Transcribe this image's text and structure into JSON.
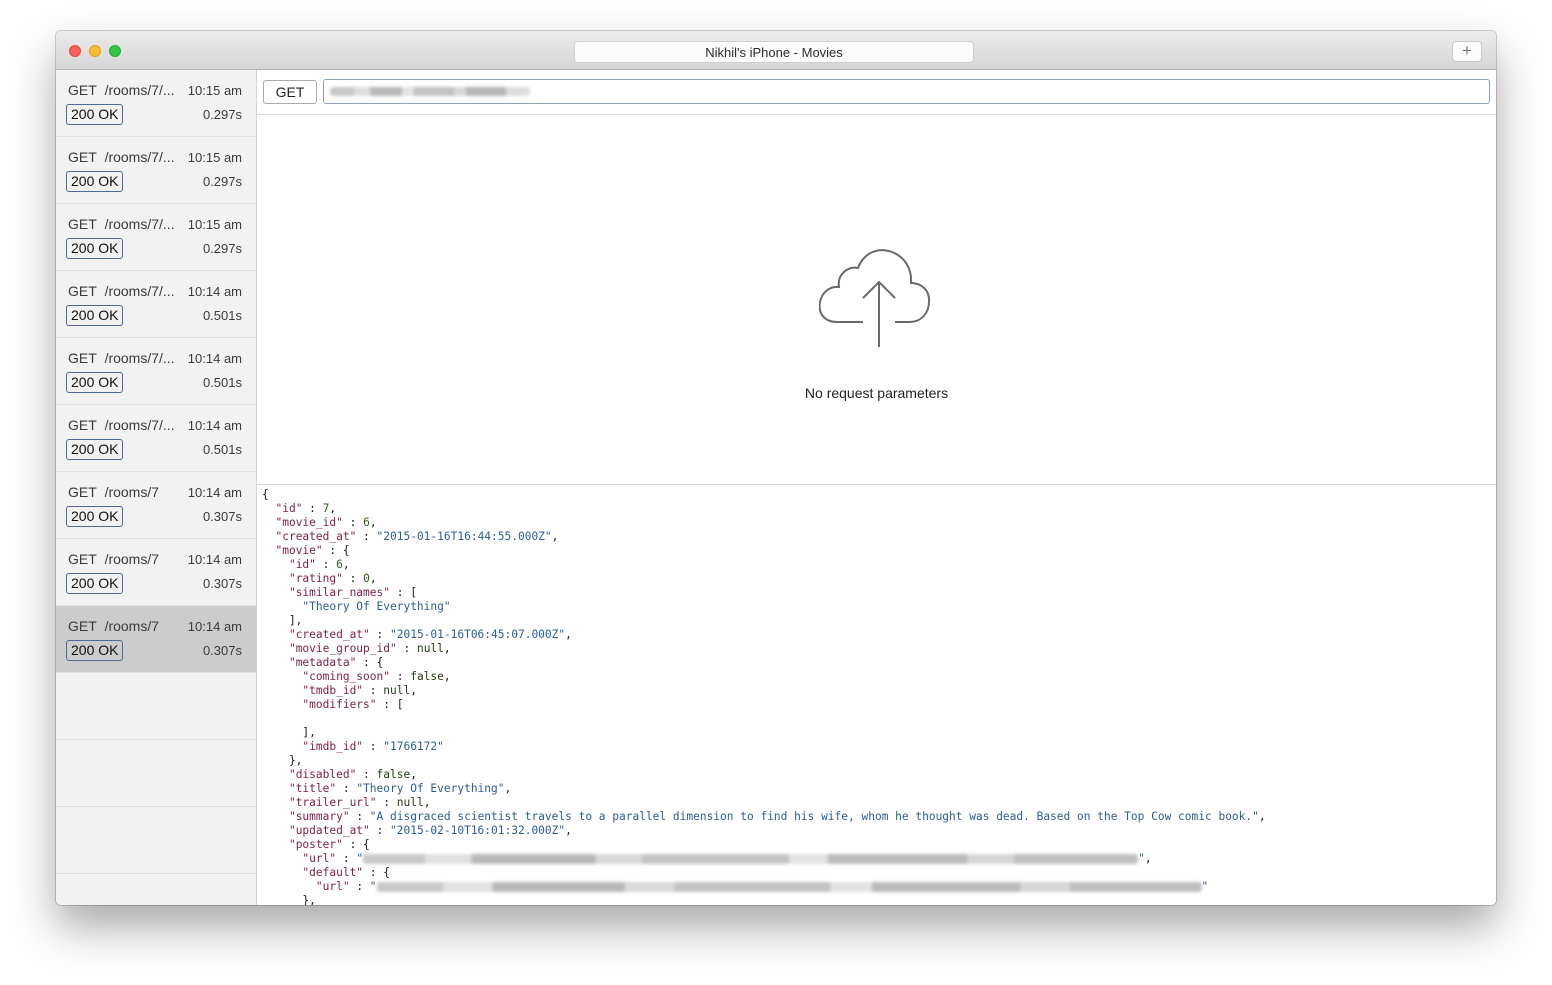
{
  "window": {
    "title": "Nikhil's iPhone - Movies",
    "add_label": "+"
  },
  "requests": [
    {
      "method": "GET",
      "path": "/rooms/7/...",
      "time": "10:15 am",
      "status": "200 OK",
      "duration": "0.297s",
      "selected": false
    },
    {
      "method": "GET",
      "path": "/rooms/7/...",
      "time": "10:15 am",
      "status": "200 OK",
      "duration": "0.297s",
      "selected": false
    },
    {
      "method": "GET",
      "path": "/rooms/7/...",
      "time": "10:15 am",
      "status": "200 OK",
      "duration": "0.297s",
      "selected": false
    },
    {
      "method": "GET",
      "path": "/rooms/7/...",
      "time": "10:14 am",
      "status": "200 OK",
      "duration": "0.501s",
      "selected": false
    },
    {
      "method": "GET",
      "path": "/rooms/7/...",
      "time": "10:14 am",
      "status": "200 OK",
      "duration": "0.501s",
      "selected": false
    },
    {
      "method": "GET",
      "path": "/rooms/7/...",
      "time": "10:14 am",
      "status": "200 OK",
      "duration": "0.501s",
      "selected": false
    },
    {
      "method": "GET",
      "path": "/rooms/7",
      "time": "10:14 am",
      "status": "200 OK",
      "duration": "0.307s",
      "selected": false
    },
    {
      "method": "GET",
      "path": "/rooms/7",
      "time": "10:14 am",
      "status": "200 OK",
      "duration": "0.307s",
      "selected": false
    },
    {
      "method": "GET",
      "path": "/rooms/7",
      "time": "10:14 am",
      "status": "200 OK",
      "duration": "0.307s",
      "selected": true
    }
  ],
  "urlbar": {
    "method": "GET"
  },
  "params": {
    "icon": "cloud-upload-icon",
    "empty_text": "No request parameters"
  },
  "response": {
    "id": "7",
    "movie_id": "6",
    "created_at": "\"2015-01-16T16:44:55.000Z\"",
    "movie": {
      "id": "6",
      "rating": "0",
      "similar_names": [
        "\"Theory Of Everything\""
      ],
      "created_at": "\"2015-01-16T06:45:07.000Z\"",
      "movie_group_id": "null",
      "metadata": {
        "coming_soon": "false",
        "tmdb_id": "null",
        "imdb_id": "\"1766172\""
      },
      "disabled": "false",
      "title": "\"Theory Of Everything\"",
      "trailer_url": "null",
      "summary": "\"A disgraced scientist travels to a parallel dimension to find his wife, whom he thought was dead. Based on the Top Cow comic book.\"",
      "updated_at": "\"2015-02-10T16:01:32.000Z\""
    }
  },
  "colors": {
    "json_key": "#7a1f4b",
    "json_string": "#2d5c93",
    "json_number": "#2a6018",
    "selected_row": "#cccccc",
    "status_border": "#4c6a93"
  }
}
